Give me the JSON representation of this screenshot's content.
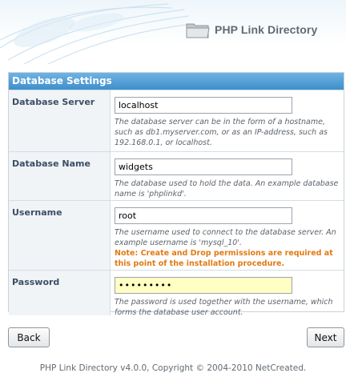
{
  "header": {
    "app_name": "PHP Link Directory"
  },
  "panel": {
    "title": "Database Settings",
    "rows": [
      {
        "label": "Database Server",
        "value": "localhost",
        "help": "The database server can be in the form of a hostname, such as db1.myserver.com, or as an IP-address, such as 192.168.0.1, or localhost."
      },
      {
        "label": "Database Name",
        "value": "widgets",
        "help": "The database used to hold the data. An example database name is 'phplinkd'."
      },
      {
        "label": "Username",
        "value": "root",
        "help": "The username used to connect to the database server. An example username is 'mysql_10'.",
        "note": "Note: Create and Drop permissions are required at this point of the installation procedure."
      },
      {
        "label": "Password",
        "value": "•••••••••",
        "help": "The password is used together with the username, which forms the database user account."
      }
    ]
  },
  "buttons": {
    "back": "Back",
    "next": "Next"
  },
  "footer": "PHP Link Directory v4.0.0, Copyright © 2004-2010 NetCreated."
}
